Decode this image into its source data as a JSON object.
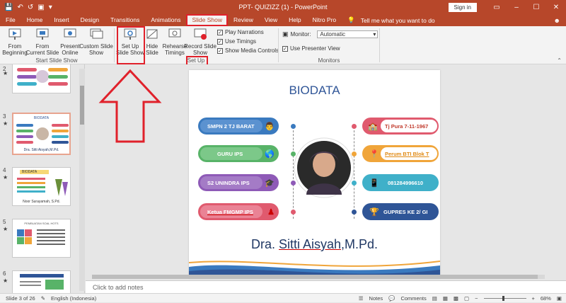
{
  "window": {
    "title": "PPT- QUIZIZZ (1)  -  PowerPoint",
    "signin": "Sign in"
  },
  "tabs": [
    "File",
    "Home",
    "Insert",
    "Design",
    "Transitions",
    "Animations",
    "Slide Show",
    "Review",
    "View",
    "Help",
    "Nitro Pro"
  ],
  "active_tab": "Slide Show",
  "tellme": "Tell me what you want to do",
  "ribbon": {
    "start": {
      "from_beginning": "From\nBeginning",
      "from_current": "From\nCurrent Slide",
      "present_online": "Present\nOnline",
      "custom_show": "Custom Slide\nShow",
      "label": "Start Slide Show"
    },
    "setup": {
      "setup_show": "Set Up\nSlide Show",
      "hide_slide": "Hide\nSlide",
      "rehearse": "Rehearse\nTimings",
      "record": "Record Slide\nShow",
      "play_narrations": "Play Narrations",
      "use_timings": "Use Timings",
      "show_media": "Show Media Controls",
      "label": "Set Up"
    },
    "monitors": {
      "monitor_label": "Monitor:",
      "monitor_value": "Automatic",
      "presenter_view": "Use Presenter View",
      "label": "Monitors"
    }
  },
  "thumbnails": [
    {
      "num": "2",
      "title": ""
    },
    {
      "num": "3",
      "title": "BIODATA",
      "caption": "Dra. Sitti Aisyah,M.Pd."
    },
    {
      "num": "4",
      "title": "BIODATA",
      "caption": "Noor Surayamah, S.Pd."
    },
    {
      "num": "5",
      "title": "PEMBUATAN SOAL HOTS"
    },
    {
      "num": "6",
      "title": ""
    }
  ],
  "slide": {
    "title": "BIODATA",
    "left_items": [
      "SMPN 2 TJ BARAT",
      "GURU IPS",
      "S2 UNINDRA IPS",
      "Ketua FMGMP IPS"
    ],
    "right_items": [
      "Tj Pura 7-11-1967",
      "Perum BTI Blok T",
      "081284996610",
      "GUPRES KE 2/ GI"
    ],
    "name_prefix": "Dra.",
    "name_main": "Sitti Aisyah",
    "name_suffix": ",M.Pd."
  },
  "notes_placeholder": "Click to add notes",
  "status": {
    "slide_count": "Slide 3 of 26",
    "language": "English (Indonesia)",
    "notes": "Notes",
    "comments": "Comments",
    "zoom": "68%"
  },
  "colors": {
    "accent": "#b7472a",
    "highlight": "#e0212b",
    "title_blue": "#2f5597"
  }
}
